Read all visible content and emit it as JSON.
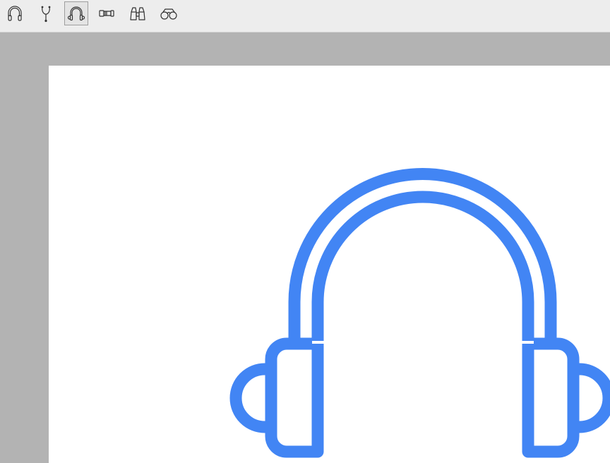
{
  "toolbar": {
    "tools": [
      {
        "icon": "headphones-icon",
        "selected": false
      },
      {
        "icon": "stethoscope-icon",
        "selected": false
      },
      {
        "icon": "headphones-outline-icon",
        "selected": true
      },
      {
        "icon": "monocular-icon",
        "selected": false
      },
      {
        "icon": "binoculars-icon",
        "selected": false
      },
      {
        "icon": "opera-glasses-icon",
        "selected": false
      }
    ]
  },
  "canvas": {
    "preview_icon": "headphones-outline-icon",
    "accent_color": "#4285f4",
    "background": "#ffffff"
  },
  "colors": {
    "toolbar_bg": "#ededed",
    "workspace_bg": "#b3b3b3",
    "icon_stroke": "#333333"
  }
}
